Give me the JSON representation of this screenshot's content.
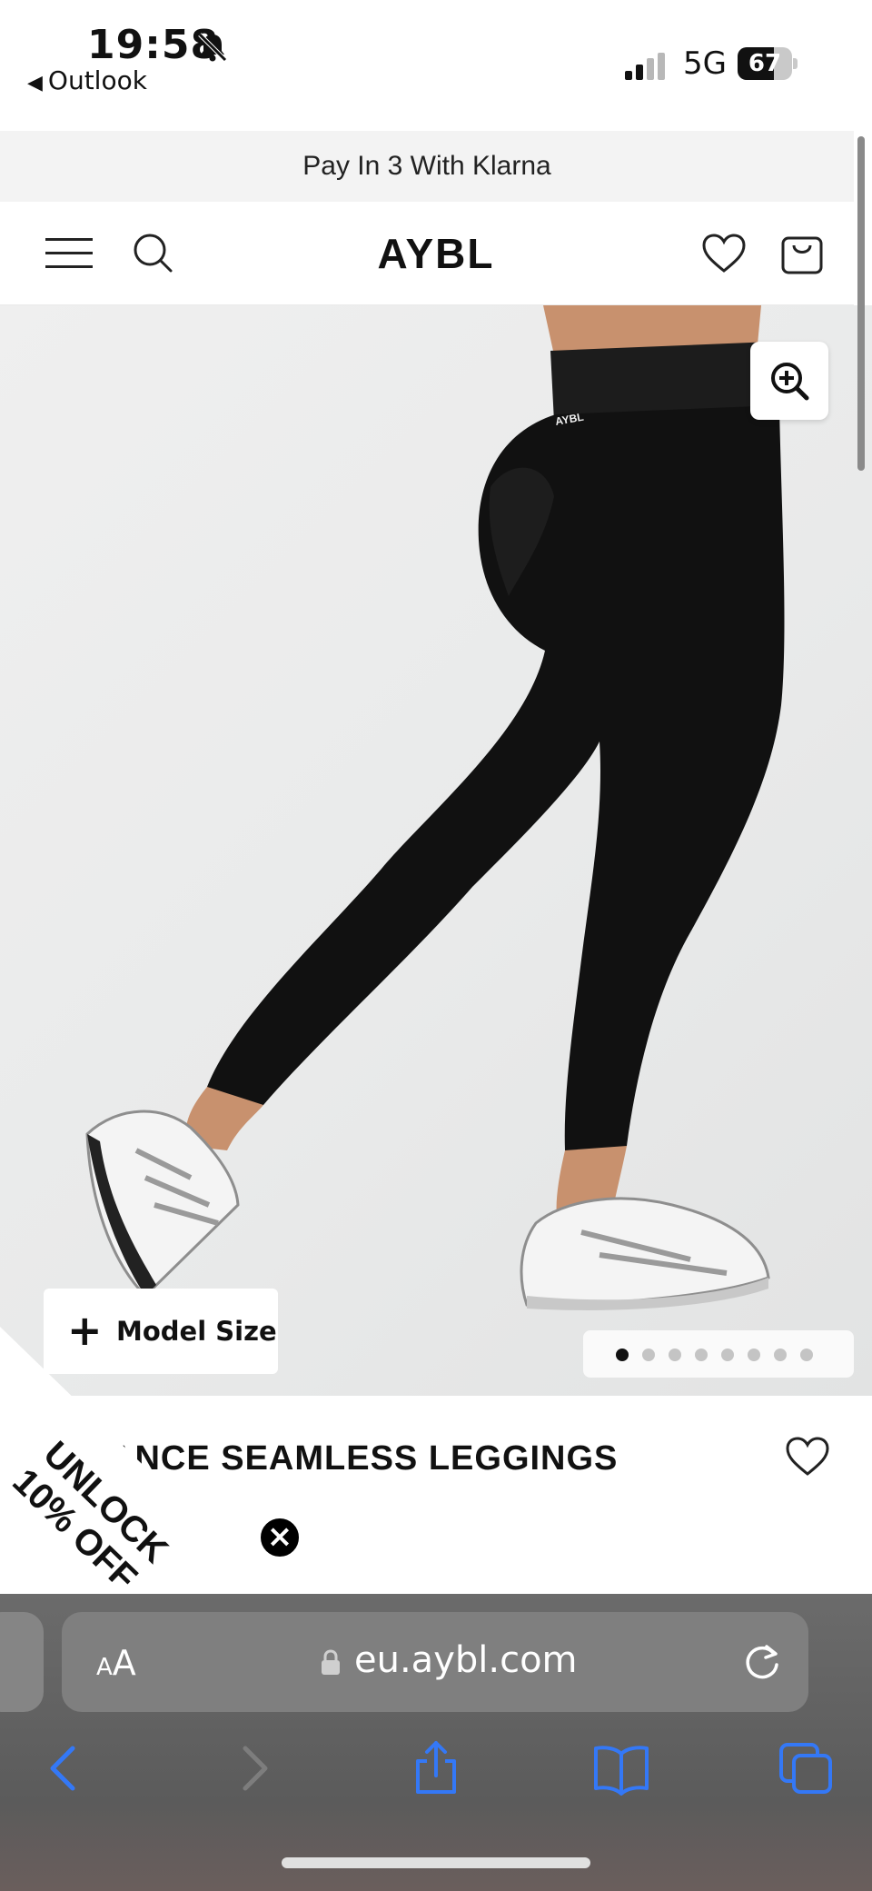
{
  "status_bar": {
    "time": "19:58",
    "back_app": "Outlook",
    "network": "5G",
    "battery": "67",
    "battery_level": 0.67
  },
  "promo": {
    "text": "Pay In 3 With Klarna"
  },
  "header": {
    "logo": "AYBL"
  },
  "gallery": {
    "model_size_label": "Model Size",
    "image_count": 8,
    "active_index": 0
  },
  "product": {
    "title_visible": "ANCE SEAMLESS LEGGINGS"
  },
  "discount_popup": {
    "line1": "UNLOCK",
    "line2": "10% OFF"
  },
  "browser": {
    "aa_small": "A",
    "aa_large": "A",
    "url": "eu.aybl.com"
  },
  "colors": {
    "accent_blue": "#3478f6",
    "product_black": "#111111",
    "promo_bg": "#f3f3f3"
  }
}
